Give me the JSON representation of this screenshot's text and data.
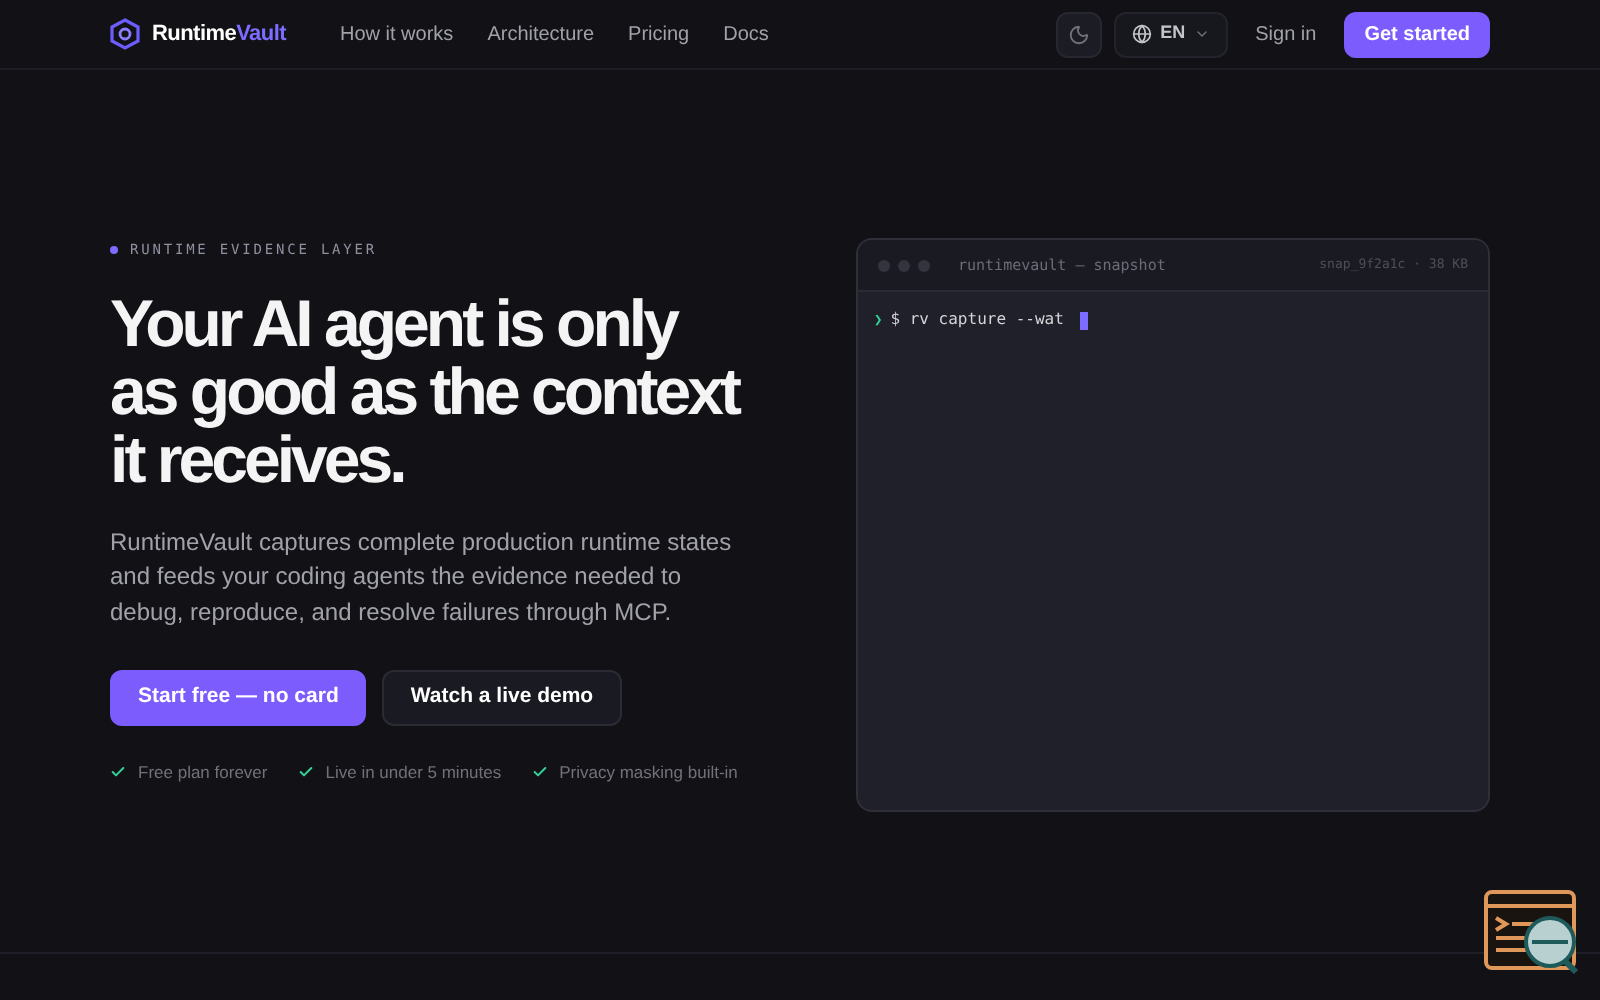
{
  "nav": {
    "brand": {
      "first": "Runtime",
      "second": "Vault"
    },
    "links": [
      "How it works",
      "Architecture",
      "Pricing",
      "Docs"
    ],
    "language": "EN",
    "sign_in": "Sign in",
    "cta": "Get started"
  },
  "hero": {
    "eyebrow": "RUNTIME EVIDENCE LAYER",
    "title": "Your AI agent is only as good as the context it receives.",
    "body": "RuntimeVault captures complete production runtime states and feeds your coding agents the evidence needed to debug, reproduce, and resolve failures through MCP.",
    "primary": "Start free — no card",
    "secondary": "Watch a live demo",
    "checks": [
      "Free plan forever",
      "Live in under 5 minutes",
      "Privacy masking built-in"
    ]
  },
  "terminal": {
    "title": "runtimevault — snapshot",
    "meta": "snap_9f2a1c · 38 KB",
    "prompt": "❯",
    "command": "$ rv capture --wat"
  }
}
